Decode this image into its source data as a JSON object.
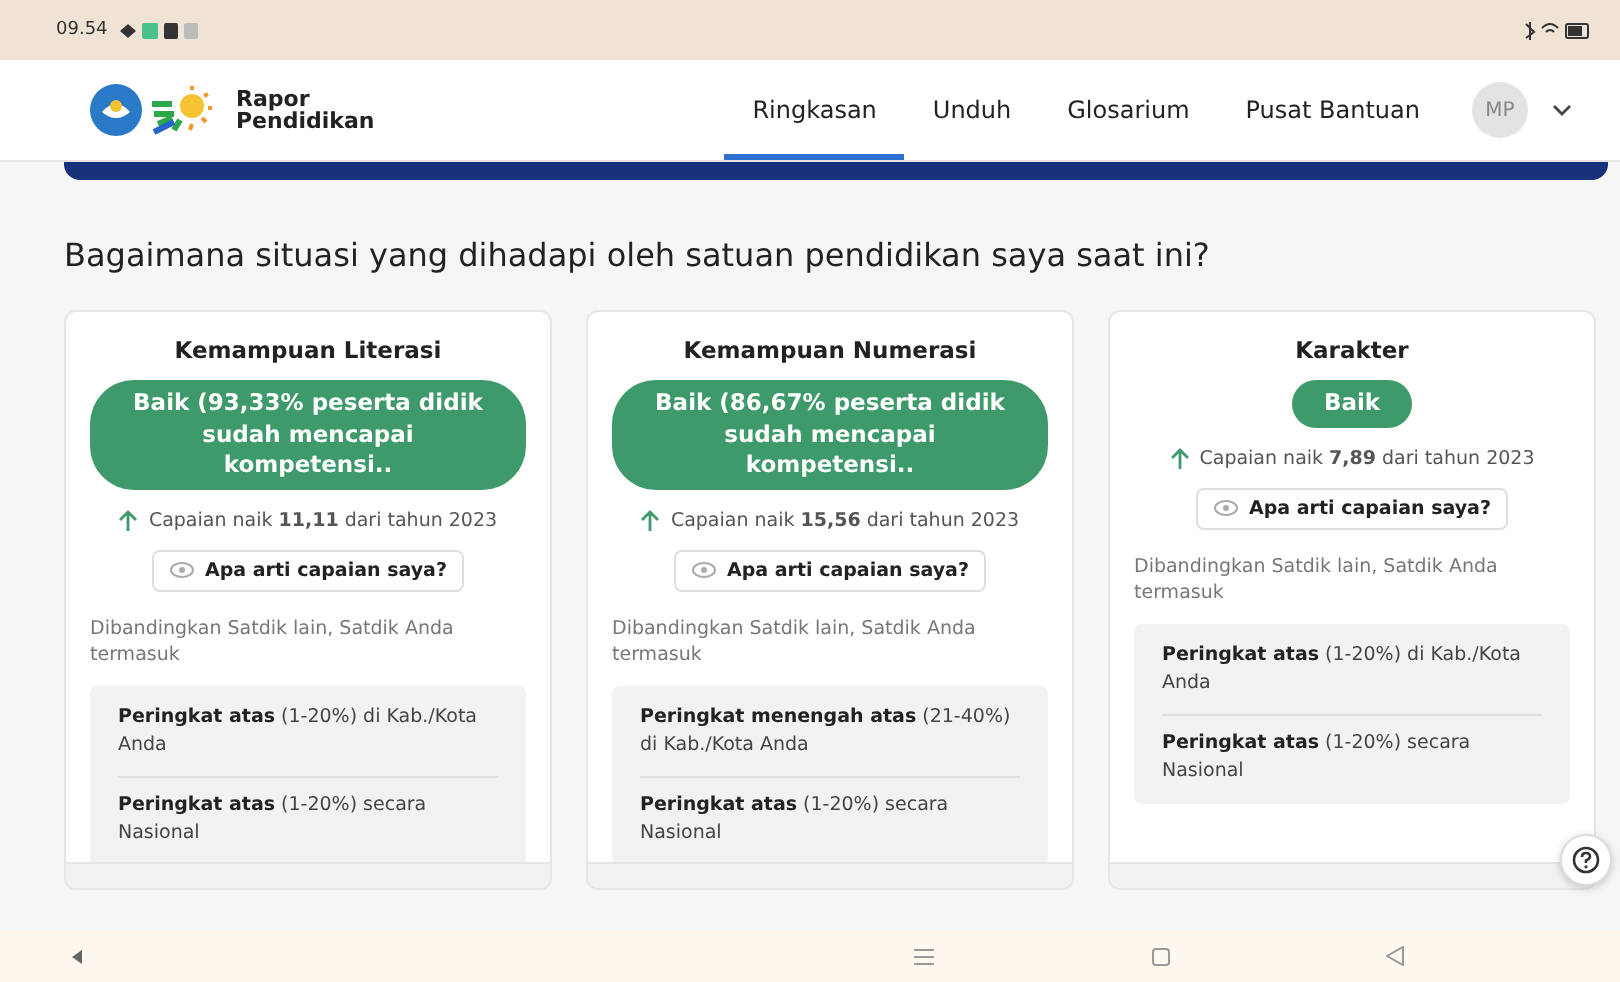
{
  "status_bar": {
    "time": "09.54"
  },
  "header": {
    "logo_text": "Rapor Pendidikan",
    "nav": [
      {
        "label": "Ringkasan",
        "selected": true
      },
      {
        "label": "Unduh",
        "selected": false
      },
      {
        "label": "Glosarium",
        "selected": false
      },
      {
        "label": "Pusat Bantuan",
        "selected": false
      }
    ],
    "avatar": "MP"
  },
  "heading": "Bagaimana situasi yang dihadapi oleh satuan pendidikan saya saat ini?",
  "cards": [
    {
      "title": "Kemampuan Literasi",
      "status": "Baik (93,33% peserta didik sudah mencapai kompetensi..",
      "trend": "Capaian naik **11,11** dari tahun 2023",
      "help": "Apa arti capaian saya?",
      "compare": "Dibandingkan Satdik lain, Satdik Anda termasuk",
      "ranks": [
        "**Peringkat atas** (1-20%) di Kab./Kota Anda",
        "**Peringkat atas** (1-20%) secara Nasional"
      ]
    },
    {
      "title": "Kemampuan Numerasi",
      "status": "Baik (86,67% peserta didik sudah mencapai kompetensi..",
      "trend": "Capaian naik **15,56** dari tahun 2023",
      "help": "Apa arti capaian saya?",
      "compare": "Dibandingkan Satdik lain, Satdik Anda termasuk",
      "ranks": [
        "**Peringkat menengah atas** (21-40%) di Kab./Kota Anda",
        "**Peringkat atas** (1-20%) secara Nasional"
      ]
    },
    {
      "title": "Karakter",
      "status": "Baik",
      "trend": "Capaian naik **7,89** dari tahun 2023",
      "help": "Apa arti capaian saya?",
      "compare": "Dibandingkan Satdik lain, Satdik Anda termasuk",
      "ranks": [
        "**Peringkat atas** (1-20%) di Kab./Kota Anda",
        "**Peringkat atas** (1-20%) secara Nasional"
      ]
    }
  ]
}
